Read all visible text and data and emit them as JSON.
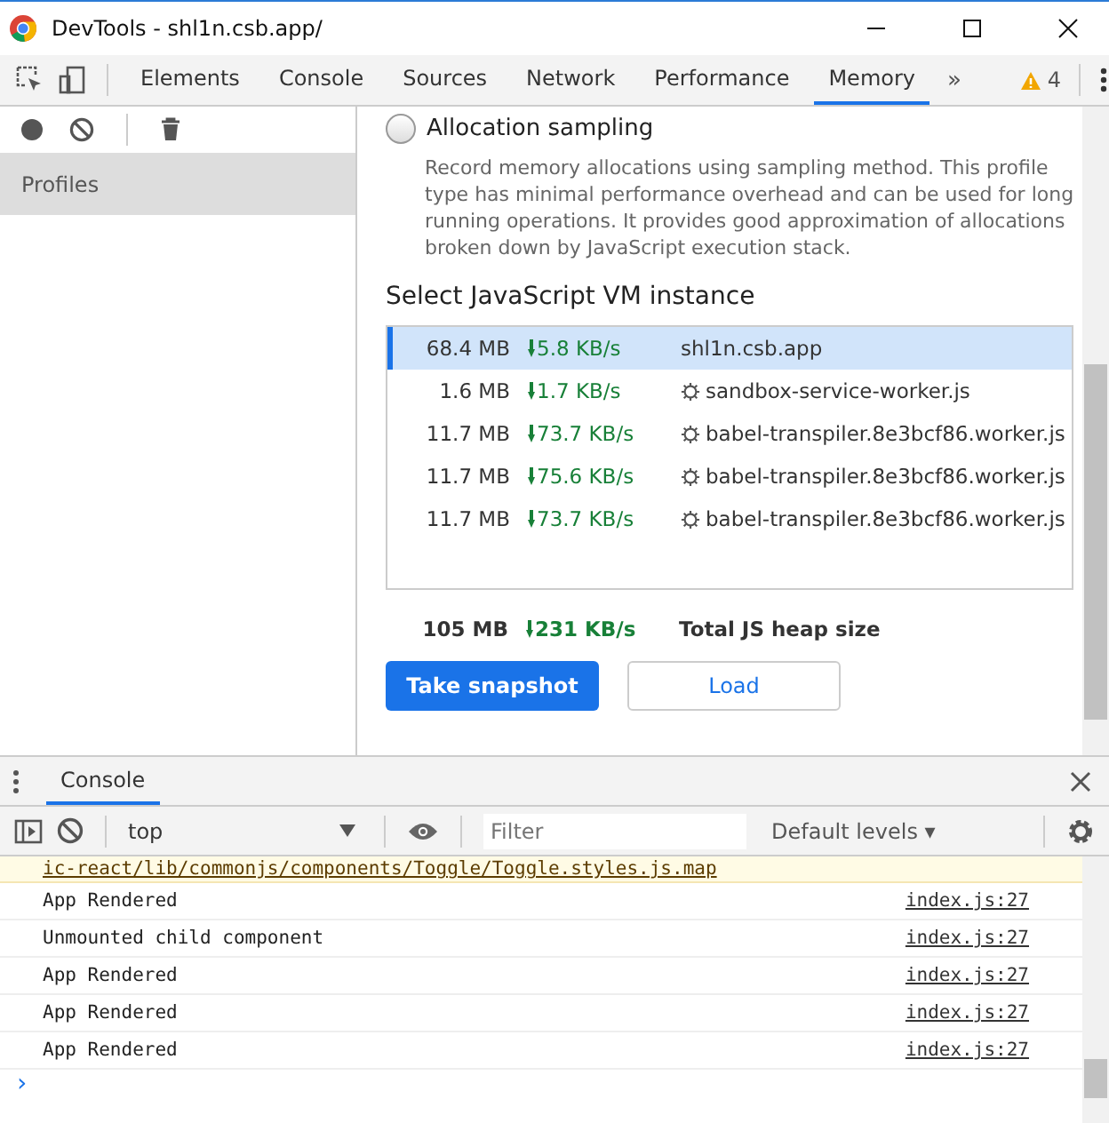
{
  "window": {
    "title": "DevTools - shl1n.csb.app/"
  },
  "tabs": [
    {
      "label": "Elements",
      "selected": false
    },
    {
      "label": "Console",
      "selected": false
    },
    {
      "label": "Sources",
      "selected": false
    },
    {
      "label": "Network",
      "selected": false
    },
    {
      "label": "Performance",
      "selected": false
    },
    {
      "label": "Memory",
      "selected": true
    }
  ],
  "more_tabs": "»",
  "warnings": {
    "count": "4"
  },
  "sidebar": {
    "items": [
      {
        "label": "Profiles",
        "selected": true
      }
    ]
  },
  "profile_option": {
    "label": "Allocation sampling",
    "selected": false,
    "description": "Record memory allocations using sampling method. This profile type has minimal performance overhead and can be used for long running operations. It provides good approximation of allocations broken down by JavaScript execution stack."
  },
  "vm_heading": "Select JavaScript VM instance",
  "vm_instances": [
    {
      "size": "68.4 MB",
      "rate": "5.8 KB/s",
      "name": "shl1n.csb.app",
      "worker": false,
      "selected": true
    },
    {
      "size": "1.6 MB",
      "rate": "1.7 KB/s",
      "name": "sandbox-service-worker.js",
      "worker": true,
      "selected": false
    },
    {
      "size": "11.7 MB",
      "rate": "73.7 KB/s",
      "name": "babel-transpiler.8e3bcf86.worker.js",
      "worker": true,
      "selected": false
    },
    {
      "size": "11.7 MB",
      "rate": "75.6 KB/s",
      "name": "babel-transpiler.8e3bcf86.worker.js",
      "worker": true,
      "selected": false
    },
    {
      "size": "11.7 MB",
      "rate": "73.7 KB/s",
      "name": "babel-transpiler.8e3bcf86.worker.js",
      "worker": true,
      "selected": false
    }
  ],
  "total": {
    "size": "105 MB",
    "rate": "231 KB/s",
    "label": "Total JS heap size"
  },
  "buttons": [
    {
      "label": "Take snapshot",
      "kind": "primary"
    },
    {
      "label": "Load",
      "kind": "secondary"
    }
  ],
  "drawer": {
    "tab": "Console",
    "context": "top",
    "filter_placeholder": "Filter",
    "levels": "Default levels ▾"
  },
  "console_lines": [
    {
      "kind": "warning",
      "text": "ic-react/lib/commonjs/components/Toggle/Toggle.styles.js.map"
    },
    {
      "kind": "log",
      "text": "App Rendered",
      "source": "index.js:27"
    },
    {
      "kind": "log",
      "text": "Unmounted child component",
      "source": "index.js:27"
    },
    {
      "kind": "log",
      "text": "App Rendered",
      "source": "index.js:27"
    },
    {
      "kind": "log",
      "text": "App Rendered",
      "source": "index.js:27"
    },
    {
      "kind": "log",
      "text": "App Rendered",
      "source": "index.js:27"
    }
  ],
  "prompt": "›"
}
